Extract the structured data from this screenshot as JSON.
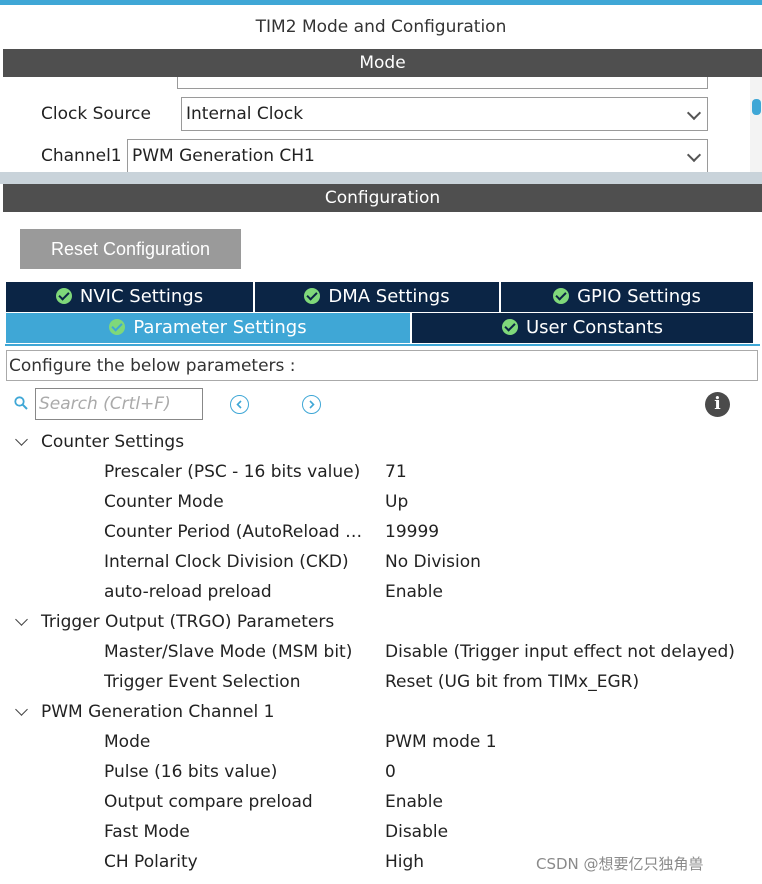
{
  "window": {
    "title": "TIM2 Mode and Configuration"
  },
  "mode": {
    "header": "Mode",
    "clock_source": {
      "label": "Clock Source",
      "value": "Internal Clock"
    },
    "channel1": {
      "label": "Channel1",
      "value": "PWM Generation CH1"
    }
  },
  "configuration": {
    "header": "Configuration",
    "reset_label": "Reset Configuration",
    "tabs": [
      {
        "label": "NVIC Settings",
        "active": false
      },
      {
        "label": "DMA Settings",
        "active": false
      },
      {
        "label": "GPIO Settings",
        "active": false
      },
      {
        "label": "Parameter Settings",
        "active": true
      },
      {
        "label": "User Constants",
        "active": false
      }
    ],
    "description": "Configure the below parameters :",
    "search": {
      "placeholder": "Search (Crtl+F)"
    },
    "groups": [
      {
        "label": "Counter Settings",
        "params": [
          {
            "name": "Prescaler (PSC - 16 bits value)",
            "value": "71"
          },
          {
            "name": "Counter Mode",
            "value": "Up"
          },
          {
            "name": "Counter Period (AutoReload …",
            "value": "19999"
          },
          {
            "name": "Internal Clock Division (CKD)",
            "value": "No Division"
          },
          {
            "name": "auto-reload preload",
            "value": "Enable"
          }
        ]
      },
      {
        "label": "Trigger Output (TRGO) Parameters",
        "params": [
          {
            "name": "Master/Slave Mode (MSM bit)",
            "value": "Disable (Trigger input effect not delayed)"
          },
          {
            "name": "Trigger Event Selection",
            "value": "Reset (UG bit from TIMx_EGR)"
          }
        ]
      },
      {
        "label": "PWM Generation Channel 1",
        "params": [
          {
            "name": "Mode",
            "value": "PWM mode 1"
          },
          {
            "name": "Pulse (16 bits value)",
            "value": "0"
          },
          {
            "name": "Output compare preload",
            "value": "Enable"
          },
          {
            "name": "Fast Mode",
            "value": "Disable"
          },
          {
            "name": "CH Polarity",
            "value": "High"
          }
        ]
      }
    ]
  },
  "watermark": "CSDN @想要亿只独角兽",
  "colors": {
    "accent": "#3fa7d6",
    "tab_dark": "#0b2545",
    "header": "#4f4f4f",
    "button": "#9a9a9a",
    "check": "#7fd87a"
  }
}
